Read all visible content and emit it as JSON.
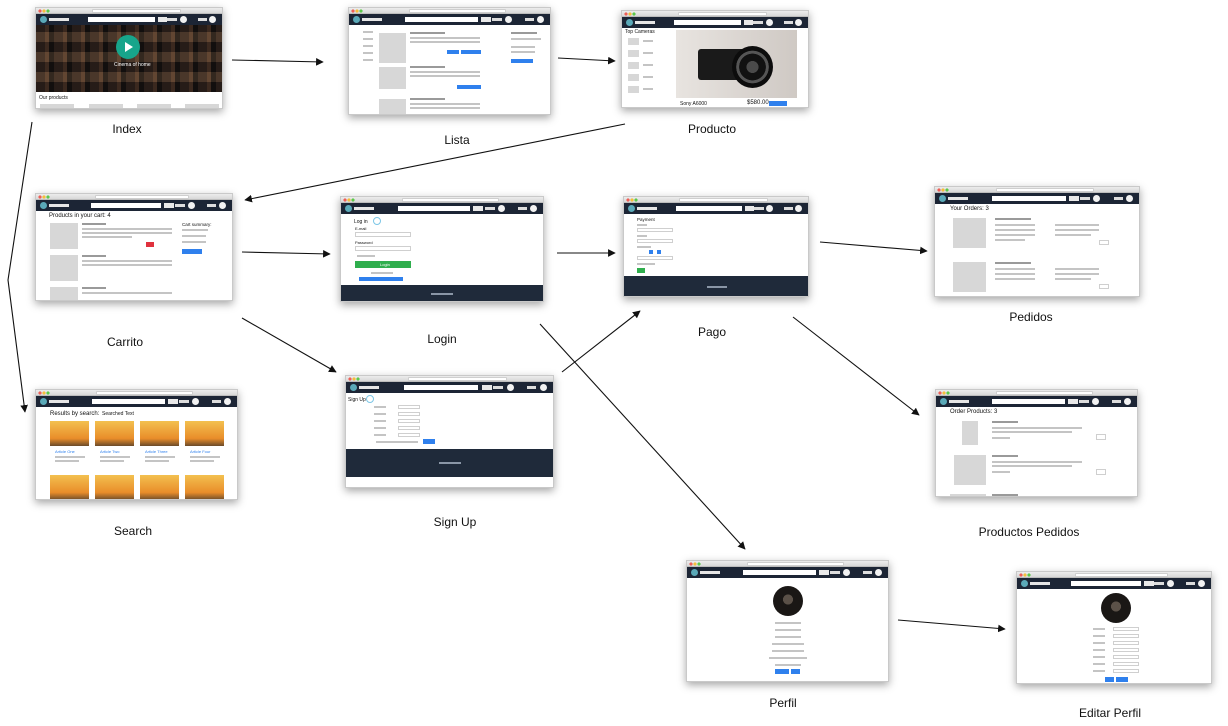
{
  "screens": [
    {
      "id": "index",
      "caption": "Index"
    },
    {
      "id": "lista",
      "caption": "Lista"
    },
    {
      "id": "producto",
      "caption": "Producto"
    },
    {
      "id": "carrito",
      "caption": "Carrito"
    },
    {
      "id": "login",
      "caption": "Login"
    },
    {
      "id": "pago",
      "caption": "Pago"
    },
    {
      "id": "pedidos",
      "caption": "Pedidos"
    },
    {
      "id": "search",
      "caption": "Search"
    },
    {
      "id": "signup",
      "caption": "Sign Up"
    },
    {
      "id": "productos_pedidos",
      "caption": "Productos Pedidos"
    },
    {
      "id": "perfil",
      "caption": "Perfil"
    },
    {
      "id": "editar_perfil",
      "caption": "Editar Perfil"
    }
  ],
  "screen_text": {
    "index": {
      "hero_title": "Cinema of home",
      "section_title": "Our products"
    },
    "producto": {
      "sidebar_title": "Top Cameras",
      "product_name": "Sony A6000",
      "price": "$580.00"
    },
    "carrito": {
      "title": "Products in your cart: 4",
      "summary_title": "Cart summary:"
    },
    "login": {
      "title": "Log in",
      "email_label": "E-mail",
      "password_label": "Password",
      "submit_label": "Login"
    },
    "pago": {
      "title": "Payment"
    },
    "pedidos": {
      "title": "Your Orders: 3"
    },
    "search": {
      "title": "Results by search:",
      "query": "Searched Text",
      "items": [
        "Article One",
        "Article Two",
        "Article Three",
        "Article Four"
      ]
    },
    "signup": {
      "title": "Sign Up"
    },
    "productos_pedidos": {
      "title": "Order Products: 3"
    }
  },
  "edges": [
    {
      "from": "index",
      "to": "lista"
    },
    {
      "from": "lista",
      "to": "producto"
    },
    {
      "from": "producto",
      "to": "carrito"
    },
    {
      "from": "index",
      "to": "search"
    },
    {
      "from": "carrito",
      "to": "login"
    },
    {
      "from": "carrito",
      "to": "signup"
    },
    {
      "from": "login",
      "to": "pago"
    },
    {
      "from": "signup",
      "to": "pago"
    },
    {
      "from": "pago",
      "to": "pedidos"
    },
    {
      "from": "pago",
      "to": "productos_pedidos"
    },
    {
      "from": "login",
      "to": "perfil"
    },
    {
      "from": "perfil",
      "to": "editar_perfil"
    }
  ],
  "colors": {
    "navbar": "#1c2535",
    "accent_blue": "#2f80ed",
    "accent_green": "#2fae4d",
    "accent_red": "#e0313e",
    "arrow": "#111111"
  }
}
